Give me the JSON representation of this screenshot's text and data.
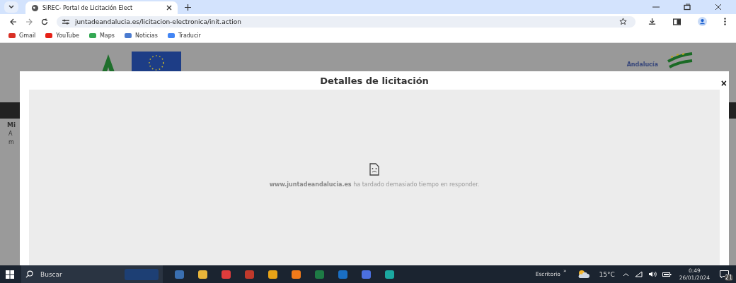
{
  "browser": {
    "tabs": [
      {
        "title": "SiREC- Portal de Licitación Elect",
        "selected": true
      }
    ],
    "url": "juntadeandalucia.es/licitacion-electronica/init.action",
    "bookmarks": [
      {
        "label": "Gmail",
        "color": "#d93025"
      },
      {
        "label": "YouTube",
        "color": "#e62117"
      },
      {
        "label": "Maps",
        "color": "#34a853"
      },
      {
        "label": "Noticias",
        "color": "#4a7bd0"
      },
      {
        "label": "Traducir",
        "color": "#4285f4"
      }
    ]
  },
  "page": {
    "side_texts": [
      "Mi",
      "A",
      "m"
    ],
    "logo_text": "Andalucía"
  },
  "modal": {
    "title": "Detalles de licitación",
    "close": "×",
    "error": "**www.juntadeandalucia.es** ha tardado demasiado tiempo en responder."
  },
  "taskbar": {
    "search_placeholder": "Buscar",
    "apps": [
      {
        "color": "#3a6fb0"
      },
      {
        "color": "#e8b53a"
      },
      {
        "color": "#e03c3c"
      },
      {
        "color": "#c0392b"
      },
      {
        "color": "#e8a317"
      },
      {
        "color": "#f07a1a"
      },
      {
        "color": "#1e7b45"
      },
      {
        "color": "#1a6fc4"
      },
      {
        "color": "#4b6fe0"
      },
      {
        "color": "#1ba8a0"
      }
    ],
    "desktop_label": "Escritorio",
    "overflow": "»",
    "temperature": "15°C",
    "time": "0:49",
    "date": "26/01/2024",
    "notifications": "21"
  }
}
